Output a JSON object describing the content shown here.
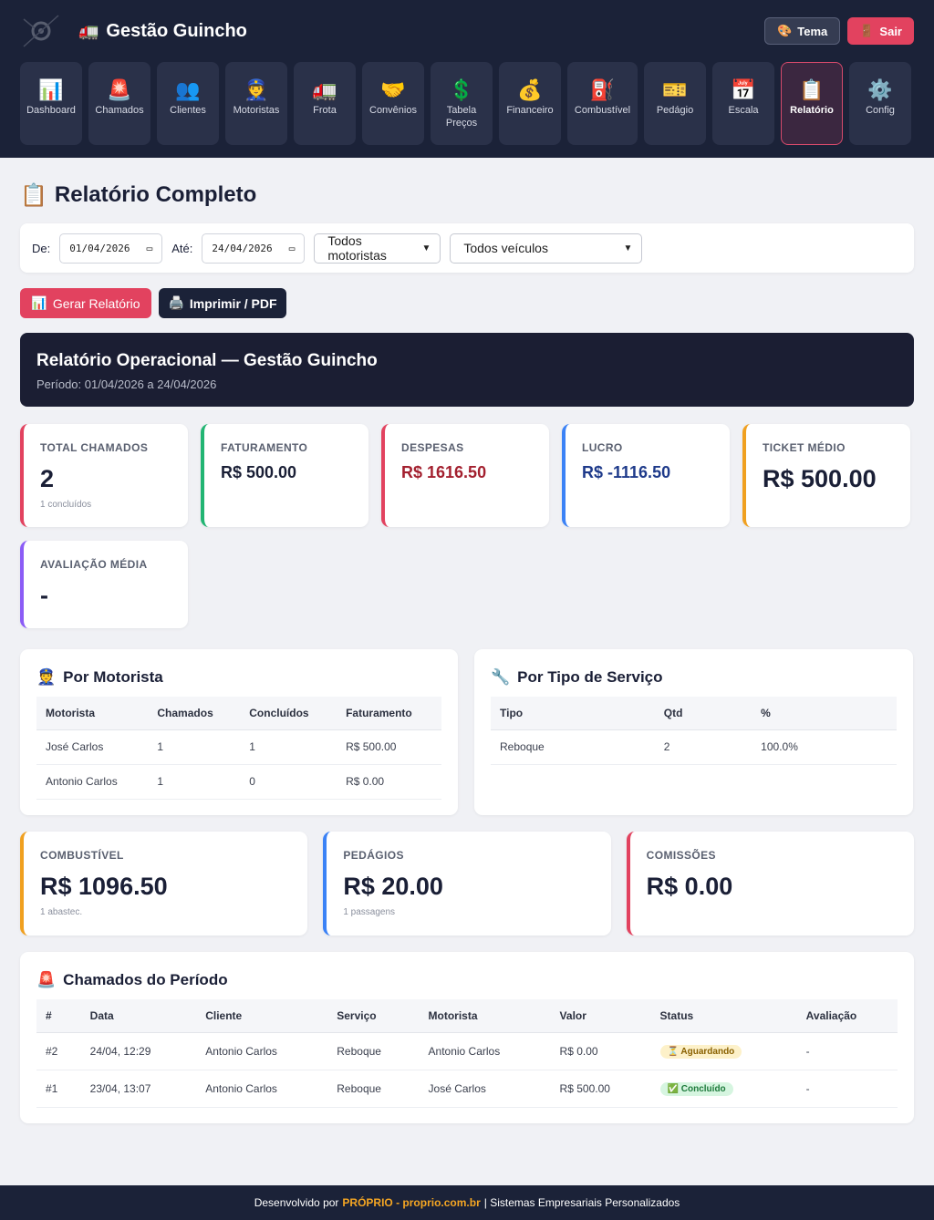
{
  "header": {
    "title": "Gestão Guincho",
    "title_icon": "🚛",
    "tema_label": "Tema",
    "tema_icon": "🎨",
    "sair_label": "Sair",
    "sair_icon": "🚪"
  },
  "nav": [
    {
      "label": "Dashboard",
      "icon": "📊"
    },
    {
      "label": "Chamados",
      "icon": "🚨"
    },
    {
      "label": "Clientes",
      "icon": "👥"
    },
    {
      "label": "Motoristas",
      "icon": "👮"
    },
    {
      "label": "Frota",
      "icon": "🚛"
    },
    {
      "label": "Convênios",
      "icon": "🤝"
    },
    {
      "label": "Tabela Preços",
      "icon": "💲"
    },
    {
      "label": "Financeiro",
      "icon": "💰"
    },
    {
      "label": "Combustível",
      "icon": "⛽"
    },
    {
      "label": "Pedágio",
      "icon": "🎫"
    },
    {
      "label": "Escala",
      "icon": "📅"
    },
    {
      "label": "Relatório",
      "icon": "📋",
      "active": true
    },
    {
      "label": "Config",
      "icon": "⚙️"
    }
  ],
  "page": {
    "title": "Relatório Completo",
    "title_icon": "📋"
  },
  "filters": {
    "de_label": "De:",
    "de_value": "01/04/2026",
    "ate_label": "Até:",
    "ate_value": "24/04/2026",
    "motoristas_value": "Todos motoristas",
    "veiculos_value": "Todos veículos"
  },
  "actions": {
    "gerar_label": "Gerar Relatório",
    "gerar_icon": "📊",
    "print_label": "Imprimir / PDF",
    "print_icon": "🖨️"
  },
  "banner": {
    "title": "Relatório Operacional — Gestão Guincho",
    "period": "Período: 01/04/2026 a 24/04/2026"
  },
  "stats": [
    {
      "label": "TOTAL CHAMADOS",
      "value": "2",
      "sub": "1 concluídos",
      "color": "#e2425f",
      "value_color": "#1a1f36",
      "small": false
    },
    {
      "label": "FATURAMENTO",
      "value": "R$ 500.00",
      "sub": "",
      "color": "#22b573",
      "value_color": "#1a1f36",
      "small": true
    },
    {
      "label": "DESPESAS",
      "value": "R$ 1616.50",
      "sub": "",
      "color": "#e2425f",
      "value_color": "#a3202f",
      "small": true
    },
    {
      "label": "LUCRO",
      "value": "R$ -1116.50",
      "sub": "",
      "color": "#3b82f6",
      "value_color": "#1e3a8a",
      "small": true
    },
    {
      "label": "TICKET MÉDIO",
      "value": "R$ 500.00",
      "sub": "",
      "color": "#f0a020",
      "value_color": "#1a1f36",
      "small": false
    },
    {
      "label": "AVALIAÇÃO MÉDIA",
      "value": "-",
      "sub": "",
      "color": "#8b5cf6",
      "value_color": "#1a1f36",
      "small": false
    }
  ],
  "por_motorista": {
    "title": "Por Motorista",
    "icon": "👮",
    "headers": [
      "Motorista",
      "Chamados",
      "Concluídos",
      "Faturamento"
    ],
    "rows": [
      [
        "José Carlos",
        "1",
        "1",
        "R$ 500.00"
      ],
      [
        "Antonio Carlos",
        "1",
        "0",
        "R$ 0.00"
      ]
    ]
  },
  "por_servico": {
    "title": "Por Tipo de Serviço",
    "icon": "🔧",
    "headers": [
      "Tipo",
      "Qtd",
      "%"
    ],
    "rows": [
      [
        "Reboque",
        "2",
        "100.0%"
      ]
    ]
  },
  "costs": [
    {
      "label": "COMBUSTÍVEL",
      "value": "R$ 1096.50",
      "sub": "1 abastec.",
      "color": "#f0a020"
    },
    {
      "label": "PEDÁGIOS",
      "value": "R$ 20.00",
      "sub": "1 passagens",
      "color": "#3b82f6"
    },
    {
      "label": "COMISSÕES",
      "value": "R$ 0.00",
      "sub": "",
      "color": "#e2425f"
    }
  ],
  "chamados": {
    "title": "Chamados do Período",
    "icon": "🚨",
    "headers": [
      "#",
      "Data",
      "Cliente",
      "Serviço",
      "Motorista",
      "Valor",
      "Status",
      "Avaliação"
    ],
    "rows": [
      {
        "id": "#2",
        "data": "24/04, 12:29",
        "cliente": "Antonio Carlos",
        "servico": "Reboque",
        "motorista": "Antonio Carlos",
        "valor": "R$ 0.00",
        "status": "⏳ Aguardando",
        "status_type": "warn",
        "avaliacao": "-"
      },
      {
        "id": "#1",
        "data": "23/04, 13:07",
        "cliente": "Antonio Carlos",
        "servico": "Reboque",
        "motorista": "José Carlos",
        "valor": "R$ 500.00",
        "status": "✅ Concluído",
        "status_type": "ok",
        "avaliacao": "-"
      }
    ]
  },
  "footer": {
    "prefix": "Desenvolvido por",
    "highlight": "PRÓPRIO - proprio.com.br",
    "suffix": "| Sistemas Empresariais Personalizados"
  }
}
